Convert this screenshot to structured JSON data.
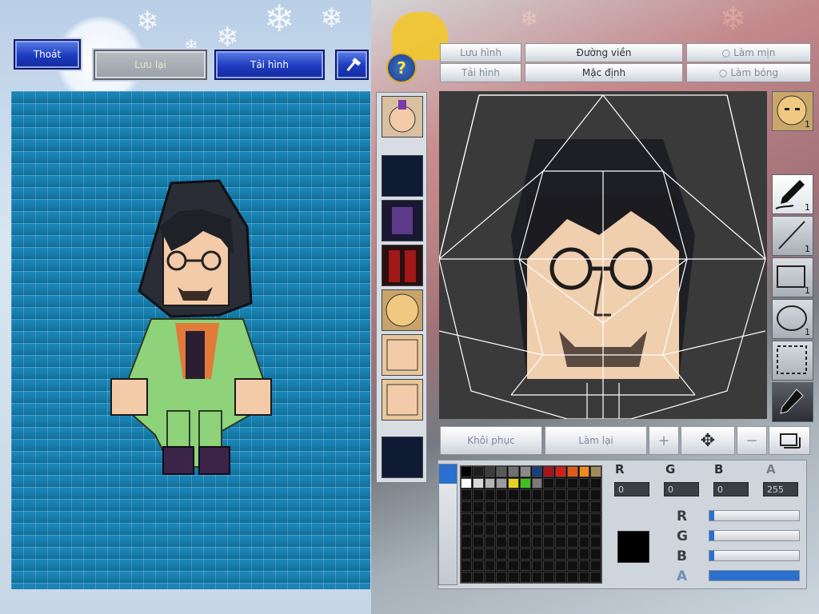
{
  "top_buttons": {
    "exit": "Thoát",
    "save": "Lưu lại",
    "reload_image": "Tải hình"
  },
  "editor_toolbar": {
    "save_image": "Lưu hình",
    "reload_image": "Tải hình",
    "outline": "Đường viền",
    "default": "Mặc định",
    "smooth": "Làm mịn",
    "shine": "Làm bóng"
  },
  "editor_actions": {
    "restore": "Khôi phục",
    "redo": "Làm lại"
  },
  "tools": {
    "pen_count": "1",
    "line_count": "1",
    "rect_count": "1",
    "ellipse_count": "1",
    "part_face_count": "1"
  },
  "color": {
    "r_label": "R",
    "g_label": "G",
    "b_label": "B",
    "a_label": "A",
    "r_value": "0",
    "g_value": "0",
    "b_value": "0",
    "a_value": "255",
    "current_color": "#000000",
    "sliders": {
      "r": 0.05,
      "g": 0.05,
      "b": 0.05,
      "a": 1.0
    }
  },
  "palette_colors": [
    "#000000",
    "#1e1e1e",
    "#3c3c3c",
    "#5a5a5a",
    "#707070",
    "#8a8a8a",
    "#1c3f7a",
    "#a8141a",
    "#d0201c",
    "#e05a16",
    "#f08a1a",
    "#a08a5a",
    "#ffffff",
    "#d8d8d8",
    "#b4b4b4",
    "#9c9c9c",
    "#e8d020",
    "#40c020",
    "#7a7a7a"
  ],
  "accent": "#1d3bbf"
}
